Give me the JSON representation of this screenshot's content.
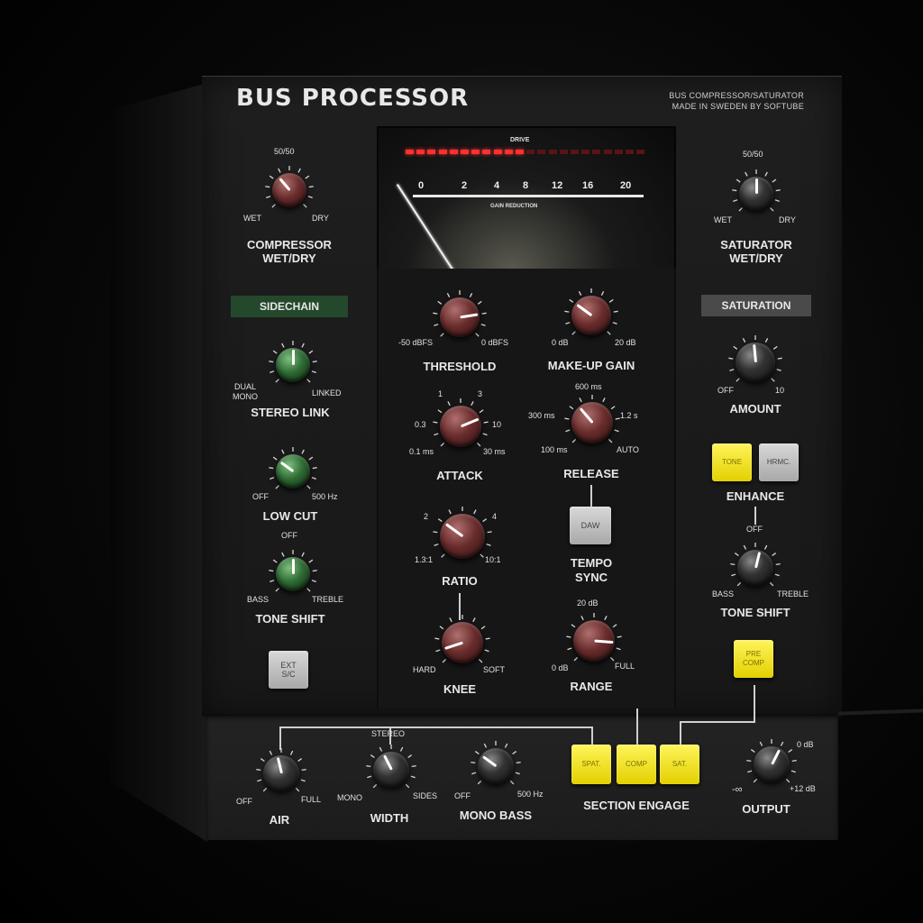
{
  "header": {
    "title": "BUS PROCESSOR",
    "subtitle_line1": "BUS COMPRESSOR/SATURATOR",
    "subtitle_line2": "MADE IN SWEDEN BY SOFTUBE"
  },
  "meter": {
    "drive_label": "DRIVE",
    "gain_reduction_label": "GAIN REDUCTION",
    "scale": [
      "0",
      "2",
      "4",
      "8",
      "12",
      "16",
      "20"
    ],
    "drive_leds_lit": 11,
    "drive_leds_total": 22
  },
  "compressor_wet_dry": {
    "label_line1": "COMPRESSOR",
    "label_line2": "WET/DRY",
    "top": "50/50",
    "left": "WET",
    "right": "DRY",
    "value": 0.35
  },
  "saturator_wet_dry": {
    "label_line1": "SATURATOR",
    "label_line2": "WET/DRY",
    "top": "50/50",
    "left": "WET",
    "right": "DRY",
    "value": 0.5
  },
  "sidechain": {
    "badge": "SIDECHAIN",
    "stereo_link": {
      "label": "STEREO LINK",
      "left_line1": "DUAL",
      "left_line2": "MONO",
      "right": "LINKED",
      "value": 0.5
    },
    "low_cut": {
      "label": "LOW CUT",
      "left": "OFF",
      "right": "500 Hz",
      "value": 0.3
    },
    "tone_shift": {
      "label": "TONE SHIFT",
      "top": "OFF",
      "left": "BASS",
      "right": "TREBLE",
      "value": 0.5
    },
    "ext_sc": {
      "line1": "EXT",
      "line2": "S/C"
    }
  },
  "compressor": {
    "threshold": {
      "label": "THRESHOLD",
      "left": "-50 dBFS",
      "right": "0 dBFS",
      "value": 0.8
    },
    "makeup_gain": {
      "label": "MAKE-UP GAIN",
      "left": "0 dB",
      "right": "20 dB",
      "value": 0.3
    },
    "attack": {
      "label": "ATTACK",
      "values": [
        "1",
        "3",
        "0.3",
        "10",
        "0.1 ms",
        "30 ms"
      ],
      "value": 0.75
    },
    "release": {
      "label": "RELEASE",
      "values": [
        "600 ms",
        "300 ms",
        "1.2 s",
        "100 ms",
        "AUTO"
      ],
      "value": 0.35
    },
    "ratio": {
      "label": "RATIO",
      "values": [
        "2",
        "4",
        "1.3:1",
        "10:1"
      ],
      "value": 0.3
    },
    "tempo_sync": {
      "button": "DAW",
      "label_line1": "TEMPO",
      "label_line2": "SYNC"
    },
    "knee": {
      "label": "KNEE",
      "left": "HARD",
      "right": "SOFT",
      "value": 0.1
    },
    "range": {
      "label": "RANGE",
      "top": "20 dB",
      "left": "0 dB",
      "right": "FULL",
      "value": 0.85
    }
  },
  "saturation": {
    "badge": "SATURATION",
    "amount": {
      "label": "AMOUNT",
      "left": "OFF",
      "right": "10",
      "value": 0.48
    },
    "enhance": {
      "label": "ENHANCE",
      "tone": "TONE",
      "harmonics": "HRMC."
    },
    "tone_shift": {
      "label": "TONE SHIFT",
      "top": "OFF",
      "left": "BASS",
      "right": "TREBLE",
      "value": 0.55
    },
    "pre_comp": {
      "line1": "PRE",
      "line2": "COMP"
    }
  },
  "bottom": {
    "stereo_label": "STEREO",
    "air": {
      "label": "AIR",
      "left": "OFF",
      "right": "FULL",
      "value": 0.45
    },
    "width": {
      "label": "WIDTH",
      "left": "MONO",
      "right": "SIDES",
      "value": 0.4
    },
    "mono_bass": {
      "label": "MONO BASS",
      "left": "OFF",
      "right": "500 Hz",
      "value": 0.3
    },
    "section_engage": {
      "label": "SECTION ENGAGE",
      "spat": "SPAT.",
      "comp": "COMP",
      "sat": "SAT."
    },
    "output": {
      "label": "OUTPUT",
      "top": "0 dB",
      "left": "-∞",
      "right": "+12 dB",
      "value": 0.6
    }
  },
  "colors": {
    "yellow_button": "#f0e21c",
    "grey_button": "#c4c4c4",
    "sidechain_badge": "#24482b",
    "saturation_badge": "#4a4a4a",
    "led_lit": "#ff3030",
    "led_dim": "#5a1414"
  }
}
